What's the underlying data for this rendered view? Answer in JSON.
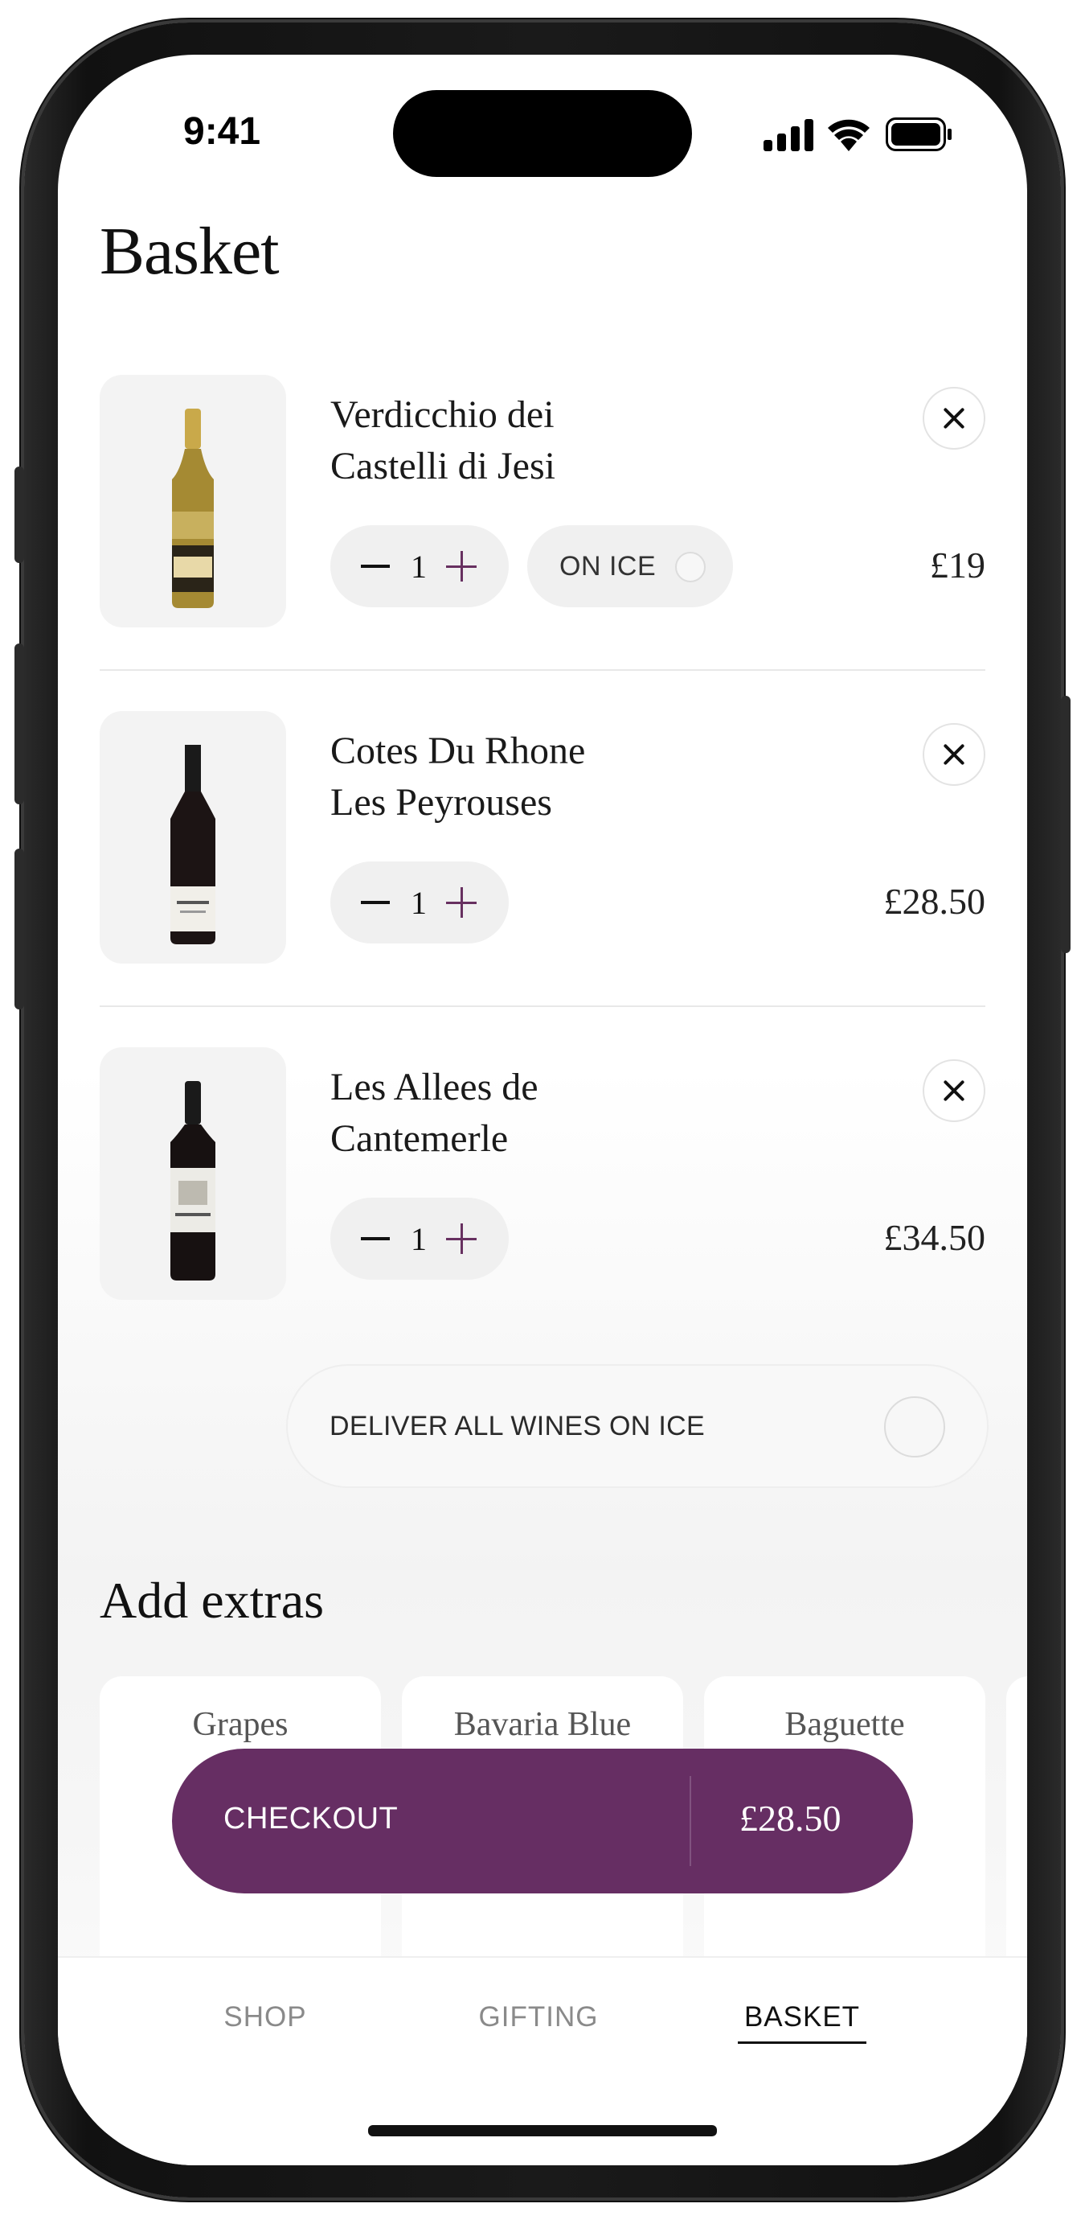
{
  "status_bar": {
    "time": "9:41"
  },
  "page": {
    "title": "Basket"
  },
  "items": [
    {
      "name_line1": "Verdicchio dei",
      "name_line2": "Castelli di Jesi",
      "quantity": "1",
      "price": "£19",
      "on_ice_label": "ON ICE",
      "bottle": "white-wine-bottle"
    },
    {
      "name_line1": "Cotes Du Rhone",
      "name_line2": "Les Peyrouses",
      "quantity": "1",
      "price": "£28.50",
      "bottle": "red-wine-bottle"
    },
    {
      "name_line1": "Les Allees de",
      "name_line2": "Cantemerle",
      "quantity": "1",
      "price": "£34.50",
      "bottle": "red-wine-bottle"
    }
  ],
  "deliver_on_ice": {
    "label": "DELIVER ALL WINES ON ICE"
  },
  "extras": {
    "title": "Add extras",
    "items": [
      {
        "label": "Grapes"
      },
      {
        "label": "Bavaria Blue"
      },
      {
        "label": "Baguette"
      }
    ]
  },
  "checkout": {
    "label": "CHECKOUT",
    "total": "£28.50"
  },
  "tabs": [
    {
      "label": "SHOP",
      "active": false
    },
    {
      "label": "GIFTING",
      "active": false
    },
    {
      "label": "BASKET",
      "active": true
    }
  ],
  "colors": {
    "accent": "#662e63",
    "white_wine": "#a58a33",
    "red_wine": "#1a1a1a"
  }
}
